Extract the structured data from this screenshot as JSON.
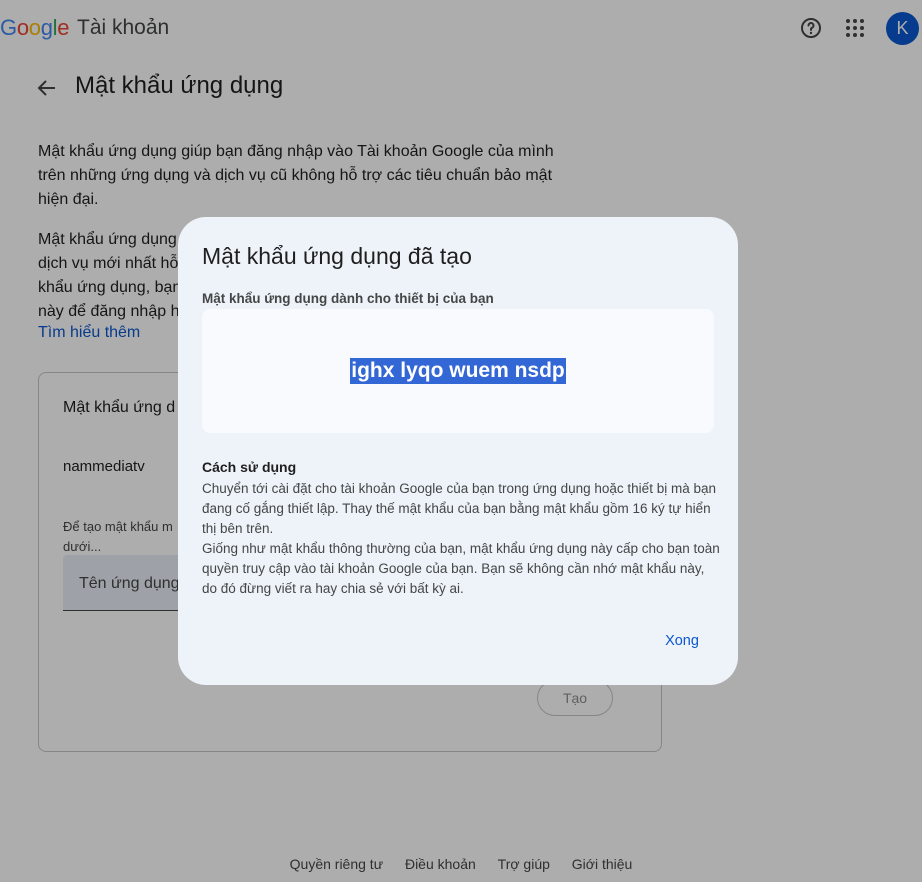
{
  "header": {
    "logo": [
      "G",
      "o",
      "o",
      "g",
      "l",
      "e"
    ],
    "product": "Tài khoản",
    "help_icon": "help-circle-icon",
    "apps_icon": "apps-grid-icon",
    "avatar_letter": "K"
  },
  "page": {
    "title": "Mật khẩu ứng dụng",
    "para1": "Mật khẩu ứng dụng giúp bạn đăng nhập vào Tài khoản Google của mình trên những ứng dụng và dịch vụ cũ không hỗ trợ các tiêu chuẩn bảo mật hiện đại.",
    "para2_lines": [
      "Mật khẩu ứng dụng",
      "dịch vụ mới nhất hỗ",
      "khẩu ứng dụng, bạn",
      "này để đăng nhập h"
    ],
    "learn_more": "Tìm hiểu thêm"
  },
  "card": {
    "title": "Mật khẩu ứng d",
    "username": "nammediatv",
    "hint_lines": [
      "Để tạo mật khẩu m",
      "dưới..."
    ],
    "input_placeholder": "Tên ứng dụng",
    "create_button": "Tạo"
  },
  "footer": {
    "links": [
      "Quyền riêng tư",
      "Điều khoản",
      "Trợ giúp",
      "Giới thiệu"
    ]
  },
  "dialog": {
    "title": "Mật khẩu ứng dụng đã tạo",
    "password_label": "Mật khẩu ứng dụng dành cho thiết bị của bạn",
    "password": "ighx lyqo wuem nsdp",
    "howto_title": "Cách sử dụng",
    "howto_para1": "Chuyển tới cài đặt cho tài khoản Google của bạn trong ứng dụng hoặc thiết bị mà bạn đang cố gắng thiết lập. Thay thế mật khẩu của bạn bằng mật khẩu gồm 16 ký tự hiển thị bên trên.",
    "howto_para2": "Giống như mật khẩu thông thường của bạn, mật khẩu ứng dụng này cấp cho bạn toàn quyền truy cập vào tài khoản Google của bạn. Bạn sẽ không cần nhớ mật khẩu này, do đó đừng viết ra hay chia sẻ với bất kỳ ai.",
    "done_button": "Xong"
  },
  "colors": {
    "accent": "#0b57d0",
    "selection": "#3367d6",
    "dialog_bg": "#eef2f9"
  }
}
